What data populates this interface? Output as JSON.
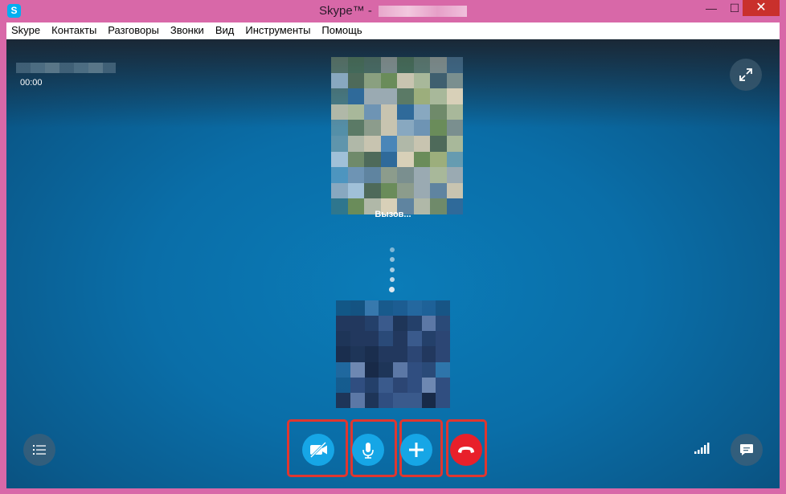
{
  "window": {
    "title": "Skype™ - ",
    "app_icon_letter": "S",
    "minimize_glyph": "—",
    "maximize_glyph": "☐",
    "close_glyph": "✕"
  },
  "menu": {
    "items": [
      "Skype",
      "Контакты",
      "Разговоры",
      "Звонки",
      "Вид",
      "Инструменты",
      "Помощь"
    ]
  },
  "call": {
    "timer": "00:00",
    "status": "Вызов...",
    "progress_dots": 5
  },
  "controls": {
    "video": {
      "icon": "video-off-icon",
      "highlighted": true
    },
    "mic": {
      "icon": "microphone-icon",
      "highlighted": true
    },
    "add": {
      "icon": "plus-icon",
      "highlighted": true
    },
    "hangup": {
      "icon": "end-call-icon",
      "highlighted": true
    }
  },
  "colors": {
    "window_frame": "#d868a8",
    "call_background": "#0a6ea8",
    "control_blue": "#16a6e6",
    "control_red": "#e8202a",
    "highlight_box": "#e0362f"
  }
}
